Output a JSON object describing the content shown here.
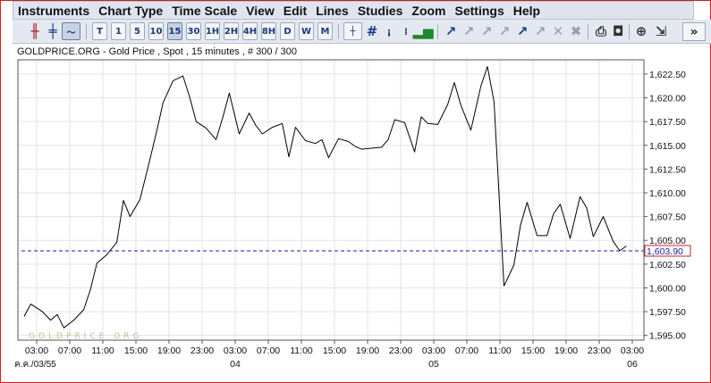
{
  "menu": [
    "Instruments",
    "Chart Type",
    "Time Scale",
    "View",
    "Edit",
    "Lines",
    "Studies",
    "Zoom",
    "Settings",
    "Help"
  ],
  "toolbar": {
    "timeframes": [
      "T",
      "1",
      "5",
      "10",
      "15",
      "30",
      "1H",
      "2H",
      "4H",
      "8H",
      "D",
      "W",
      "M"
    ],
    "selected_timeframe": "15",
    "more_label": "»"
  },
  "chart_title": "GOLDPRICE.ORG - Gold Price , Spot , 15 minutes , # 300 / 300",
  "watermark": "GOLDPRICE.ORG",
  "current_price_label": "1,603.90",
  "colors": {
    "price_line": "#000000",
    "current_price_line": "#1a1aa8",
    "grid": "#e3e3e3",
    "price_box": "#cc2020",
    "frame": "#cc2020"
  },
  "chart_data": {
    "type": "line",
    "title": "GOLDPRICE.ORG - Gold Price , Spot , 15 minutes , # 300 / 300",
    "x_tick_labels": [
      "03:00",
      "07:00",
      "11:00",
      "15:00",
      "19:00",
      "23:00",
      "03:00",
      "07:00",
      "11:00",
      "15:00",
      "19:00",
      "23:00",
      "03:00",
      "07:00",
      "11:00",
      "15:00",
      "19:00",
      "23:00",
      "03:00"
    ],
    "date_labels": [
      "ค.ค./03/55",
      "04",
      "05",
      "06"
    ],
    "y_ticks": [
      "1,595.00",
      "1,597.50",
      "1,600.00",
      "1,602.50",
      "1,605.00",
      "1,607.50",
      "1,610.00",
      "1,612.50",
      "1,615.00",
      "1,617.50",
      "1,620.00",
      "1,622.50"
    ],
    "ylim": [
      1594.5,
      1624.0
    ],
    "axis_position": "right",
    "grid": true,
    "current_price": 1603.9,
    "series": [
      {
        "x": [
          0,
          0.2,
          0.55,
          0.8,
          1.0,
          1.2,
          1.5,
          1.8,
          2.0,
          2.2,
          2.5,
          2.8,
          3.0,
          3.2,
          3.5,
          3.8,
          4.0,
          4.2,
          4.5,
          4.8,
          5.0,
          5.2,
          5.5,
          5.8,
          6.0,
          6.2,
          6.5,
          6.8,
          7.0,
          7.2,
          7.5,
          7.8,
          8.0,
          8.2,
          8.5,
          8.8,
          9.0,
          9.2,
          9.5,
          9.8,
          10.0,
          10.2,
          10.5,
          10.8,
          11.0,
          11.2,
          11.5,
          11.8,
          12.0,
          12.2,
          12.5,
          12.8,
          13.0,
          13.2,
          13.5,
          13.8,
          14.0,
          14.2,
          14.5,
          14.8,
          15.0,
          15.2,
          15.5,
          15.8,
          16.0,
          16.2,
          16.5,
          16.8,
          17.0,
          17.2,
          17.5,
          17.8,
          18.0,
          18.2
        ],
        "y": [
          1597,
          1598.3,
          1597.5,
          1596.6,
          1597.2,
          1595.8,
          1596.6,
          1597.7,
          1599.8,
          1602.6,
          1603.5,
          1604.8,
          1609.2,
          1607.5,
          1609.3,
          1613.5,
          1616.4,
          1619.5,
          1621.8,
          1622.3,
          1620.1,
          1617.5,
          1616.8,
          1615.6,
          1617.9,
          1620.5,
          1616.2,
          1618.4,
          1617.1,
          1616.2,
          1616.9,
          1617.3,
          1613.8,
          1616.9,
          1615.5,
          1615.2,
          1615.6,
          1613.7,
          1615.7,
          1615.4,
          1614.9,
          1614.6,
          1614.7,
          1614.8,
          1615.6,
          1617.7,
          1617.4,
          1614.3,
          1618.0,
          1617.3,
          1617.2,
          1619.3,
          1621.6,
          1619.2,
          1616.6,
          1621.2,
          1623.3,
          1619.6,
          1600.2,
          1602.4,
          1606.6,
          1609.0,
          1605.5,
          1605.5,
          1607.8,
          1608.8,
          1605.2,
          1609.6,
          1608.4,
          1605.4,
          1607.5,
          1604.9,
          1603.9,
          1604.4
        ]
      }
    ]
  }
}
